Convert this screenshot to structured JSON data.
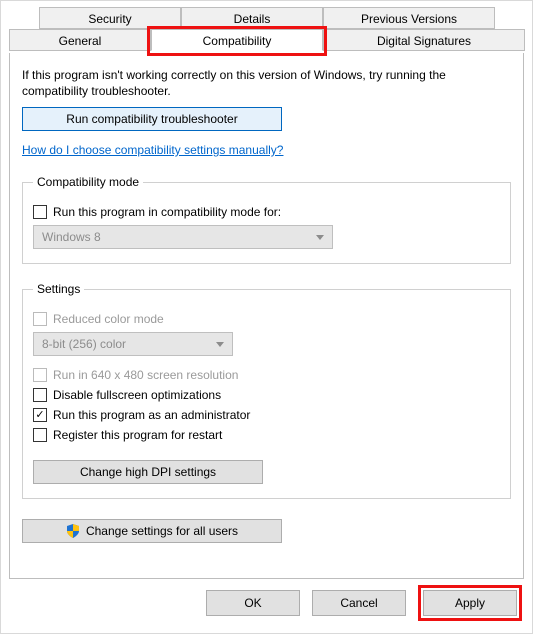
{
  "tabs": {
    "row1": [
      "Security",
      "Details",
      "Previous Versions"
    ],
    "row2": [
      "General",
      "Compatibility",
      "Digital Signatures"
    ],
    "active": "Compatibility"
  },
  "intro": "If this program isn't working correctly on this version of Windows, try running the compatibility troubleshooter.",
  "troubleshooter_button": "Run compatibility troubleshooter",
  "manual_link": "How do I choose compatibility settings manually?",
  "compat_mode": {
    "legend": "Compatibility mode",
    "checkbox_label": "Run this program in compatibility mode for:",
    "selected": "Windows 8"
  },
  "settings": {
    "legend": "Settings",
    "reduced_color_label": "Reduced color mode",
    "color_selected": "8-bit (256) color",
    "run_640_label": "Run in 640 x 480 screen resolution",
    "disable_fullscreen_label": "Disable fullscreen optimizations",
    "run_admin_label": "Run this program as an administrator",
    "register_restart_label": "Register this program for restart",
    "dpi_button": "Change high DPI settings"
  },
  "all_users_button": "Change settings for all users",
  "dialog_buttons": {
    "ok": "OK",
    "cancel": "Cancel",
    "apply": "Apply"
  }
}
